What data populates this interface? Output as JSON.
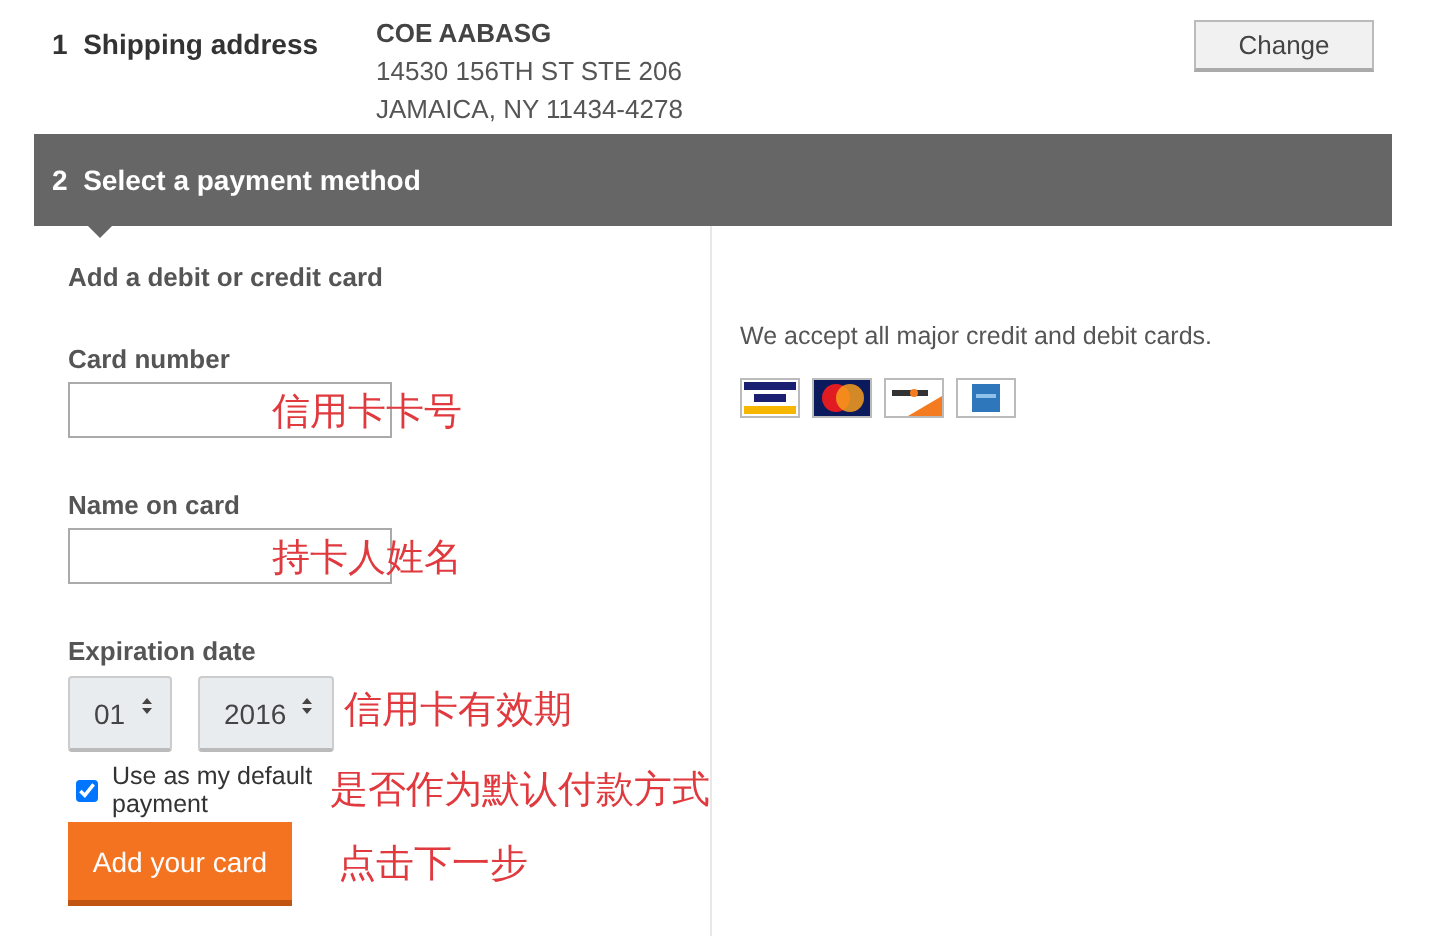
{
  "shipping": {
    "step": "1",
    "title": "Shipping address",
    "address": [
      "COE AABASG",
      "14530 156TH ST STE 206",
      "JAMAICA, NY 11434-4278"
    ],
    "button": "Change"
  },
  "payment": {
    "step": "2",
    "title": "Select a payment method",
    "subtitle": "Add a debit or credit card",
    "fields": [
      {
        "label": "Card number",
        "note": "信用卡卡号"
      },
      {
        "label": "Name on card",
        "note": "持卡人姓名"
      }
    ],
    "expiration": {
      "label": "Expiration date",
      "month": "01",
      "year": "2016",
      "note": "信用卡有效期"
    },
    "default_payment": {
      "label": "Use as my default payment",
      "checked": true,
      "note": "是否作为默认付款方式"
    },
    "submit": {
      "label": "Add your card",
      "note": "点击下一步"
    },
    "accepted": {
      "text": "We accept all major credit and debit cards.",
      "cards": [
        {
          "kind": "visa"
        },
        {
          "kind": "mastercard"
        },
        {
          "kind": "discover"
        },
        {
          "kind": "amex"
        }
      ]
    }
  }
}
